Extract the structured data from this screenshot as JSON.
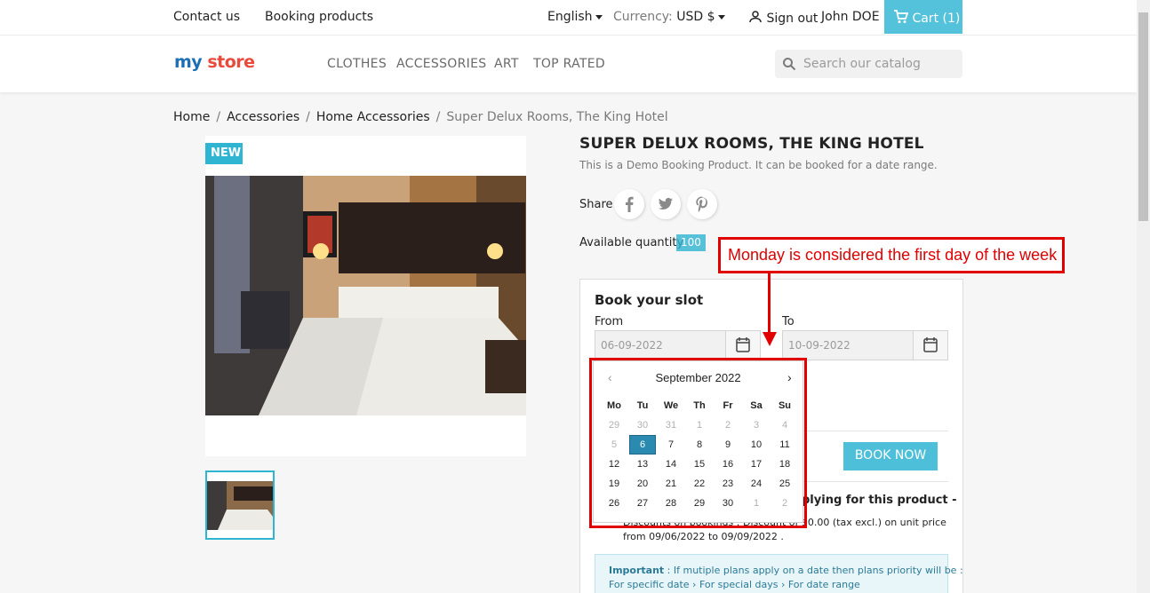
{
  "topbar": {
    "contact": "Contact us",
    "booking": "Booking products",
    "language": "English",
    "currency_label": "Currency:",
    "currency_value": "USD $",
    "signout": "Sign out",
    "user": "John DOE",
    "cart": "Cart (1)"
  },
  "header": {
    "logo_my": "my",
    "logo_store": "store",
    "nav": [
      "CLOTHES",
      "ACCESSORIES",
      "ART",
      "TOP RATED"
    ],
    "search_placeholder": "Search our catalog"
  },
  "breadcrumb": [
    "Home",
    "Accessories",
    "Home Accessories",
    "Super Delux Rooms, The King Hotel"
  ],
  "product": {
    "flag": "NEW",
    "title": "SUPER DELUX ROOMS, THE KING HOTEL",
    "description": "This is a Demo Booking Product. It can be booked for a date range.",
    "share_label": "Share",
    "available_label": "Available quantity",
    "available_qty": "100"
  },
  "booking": {
    "title": "Book your slot",
    "from_label": "From",
    "to_label": "To",
    "from_value": "06-09-2022",
    "to_value": "10-09-2022",
    "book_now": "BOOK NOW",
    "discount_title": "plying for this product -",
    "discount_line1": "Discounts on bookings : Discount of $0.00 (tax excl.) on unit price",
    "discount_line2": "from 09/06/2022 to 09/09/2022 .",
    "important_label": "Important",
    "important_text": " : If mutiple plans apply on a date then plans priority will be :",
    "important_line2": "For specific date › For special days › For date range"
  },
  "calendar": {
    "month": "September 2022",
    "prev": "‹",
    "next": "›",
    "weekdays": [
      "Mo",
      "Tu",
      "We",
      "Th",
      "Fr",
      "Sa",
      "Su"
    ],
    "weeks": [
      [
        {
          "d": "29",
          "o": true
        },
        {
          "d": "30",
          "o": true
        },
        {
          "d": "31",
          "o": true
        },
        {
          "d": "1",
          "o": true
        },
        {
          "d": "2",
          "o": true
        },
        {
          "d": "3",
          "o": true
        },
        {
          "d": "4",
          "o": true
        }
      ],
      [
        {
          "d": "5",
          "o": true
        },
        {
          "d": "6",
          "s": true
        },
        {
          "d": "7"
        },
        {
          "d": "8"
        },
        {
          "d": "9"
        },
        {
          "d": "10"
        },
        {
          "d": "11"
        }
      ],
      [
        {
          "d": "12"
        },
        {
          "d": "13"
        },
        {
          "d": "14"
        },
        {
          "d": "15"
        },
        {
          "d": "16"
        },
        {
          "d": "17"
        },
        {
          "d": "18"
        }
      ],
      [
        {
          "d": "19"
        },
        {
          "d": "20"
        },
        {
          "d": "21"
        },
        {
          "d": "22"
        },
        {
          "d": "23"
        },
        {
          "d": "24"
        },
        {
          "d": "25"
        }
      ],
      [
        {
          "d": "26"
        },
        {
          "d": "27"
        },
        {
          "d": "28"
        },
        {
          "d": "29"
        },
        {
          "d": "30"
        },
        {
          "d": "1",
          "o": true
        },
        {
          "d": "2",
          "o": true
        }
      ]
    ]
  },
  "annotation": {
    "text": "Monday is considered the first day of the week",
    "color": "#e00000"
  },
  "colors": {
    "accent": "#2fb5d2"
  }
}
